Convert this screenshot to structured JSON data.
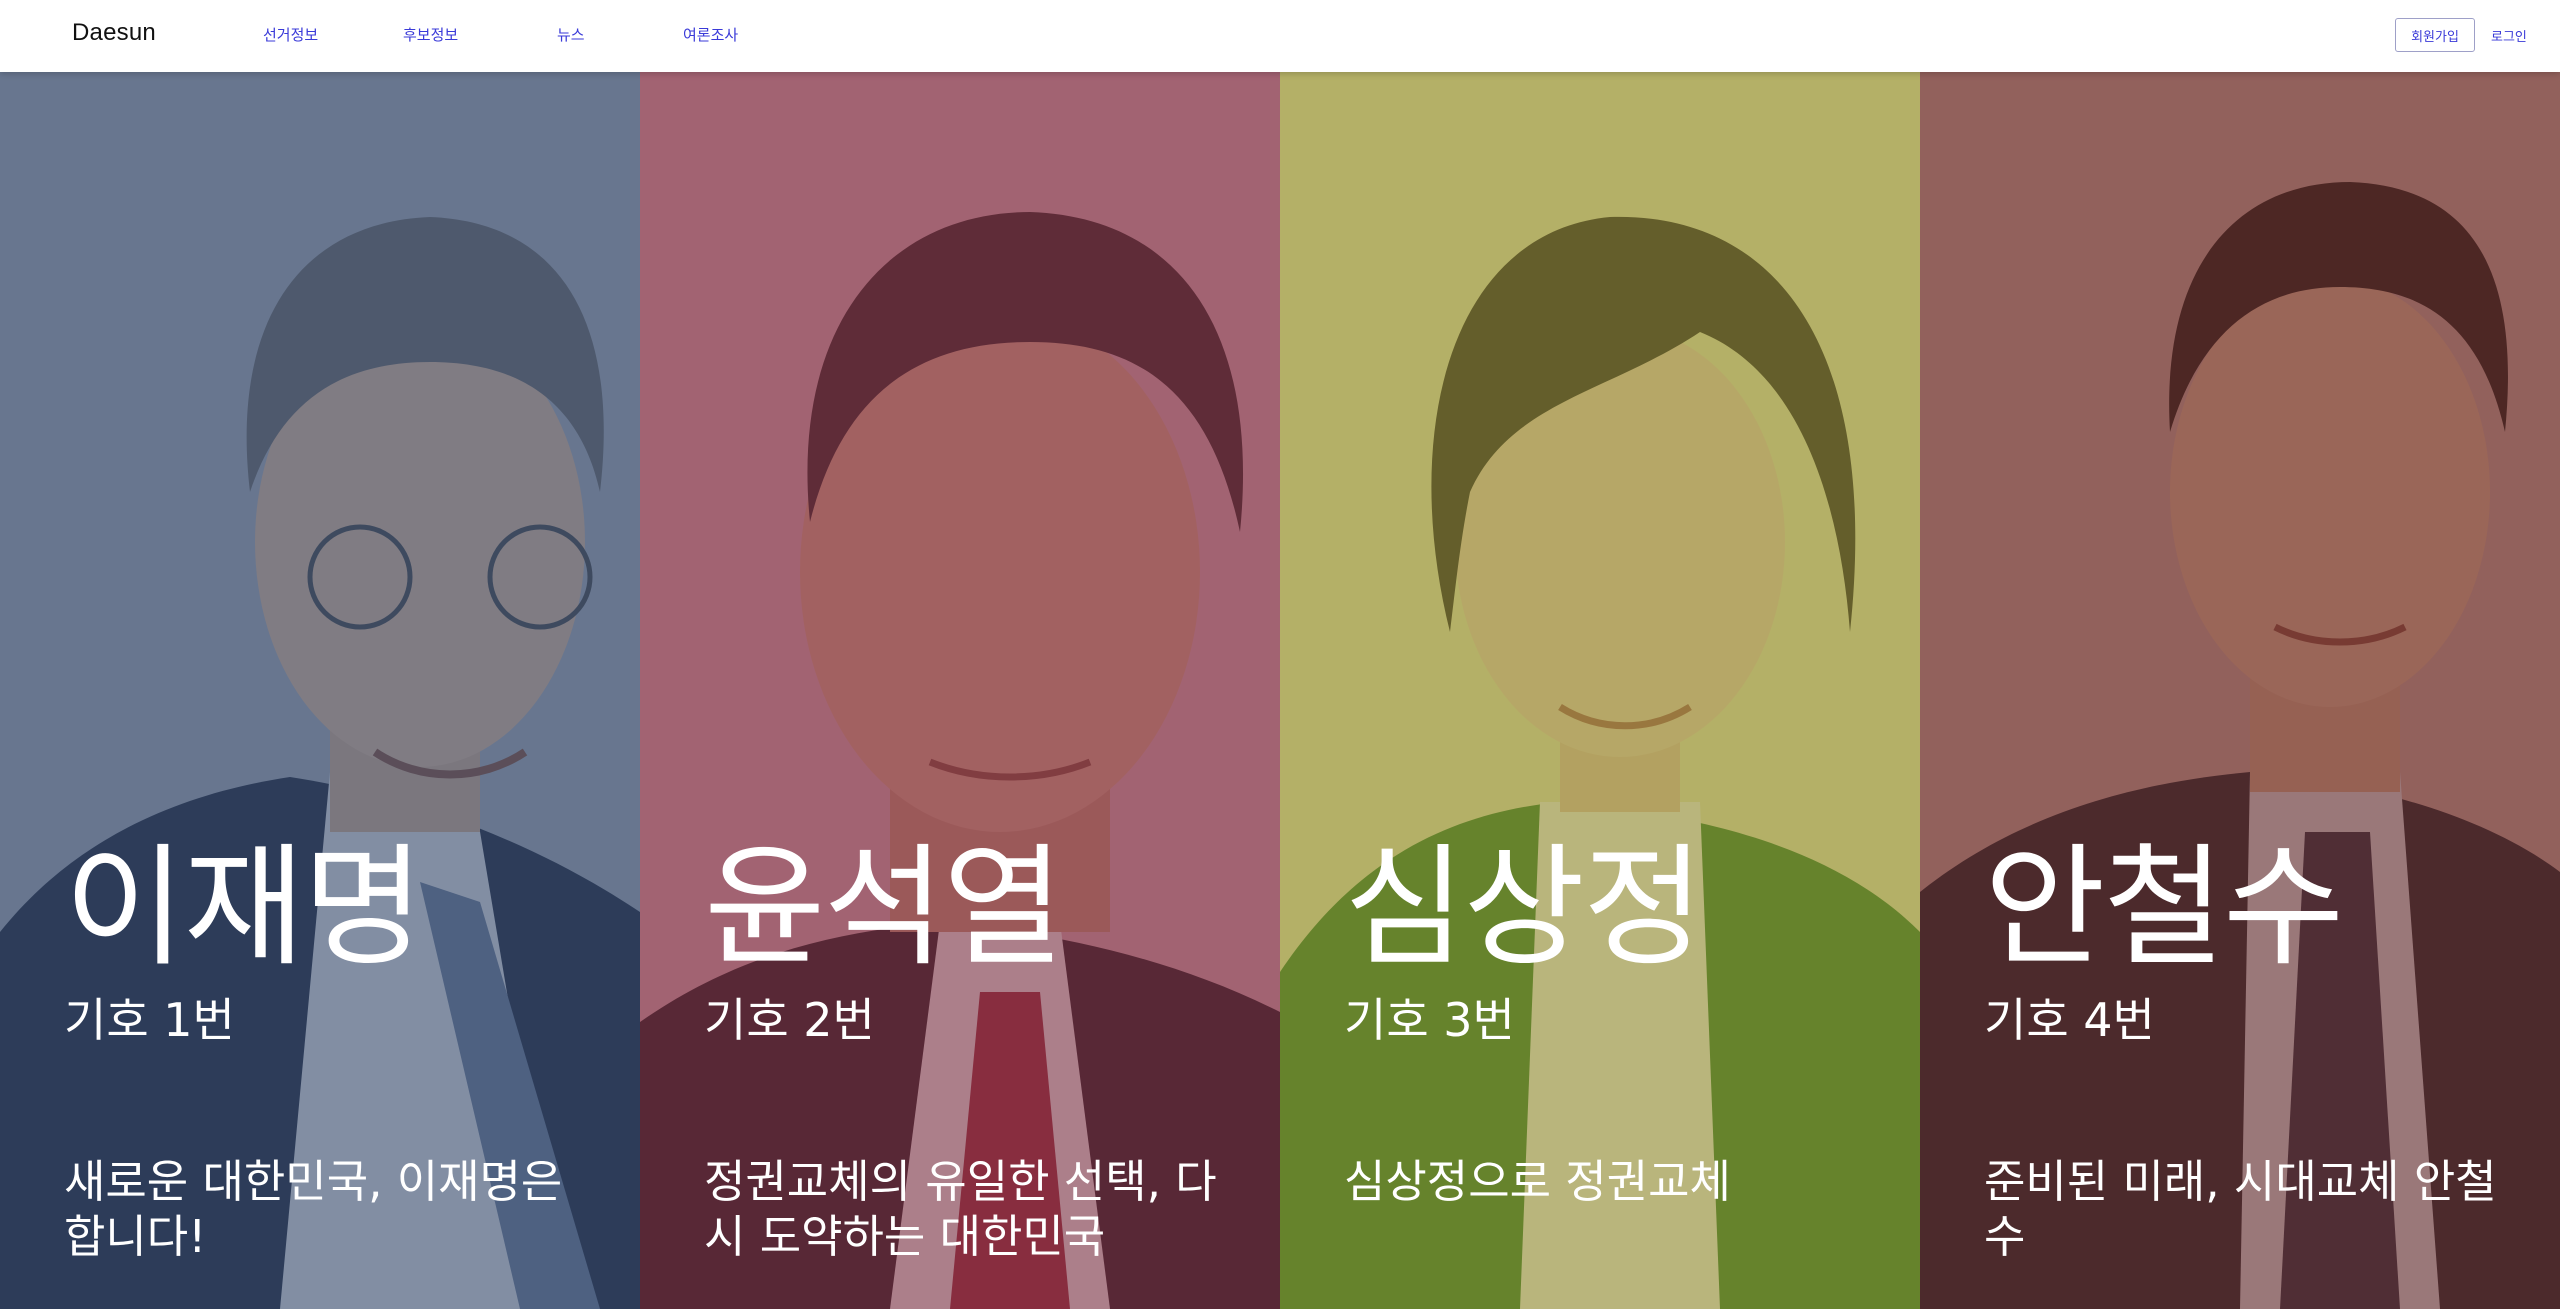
{
  "brand": "Daesun",
  "nav": {
    "items": [
      {
        "label": "선거정보"
      },
      {
        "label": "후보정보"
      },
      {
        "label": "뉴스"
      },
      {
        "label": "여론조사"
      }
    ],
    "signup_label": "회원가입",
    "login_label": "로그인"
  },
  "candidates": [
    {
      "name": "이재명",
      "number": "기호 1번",
      "slogan": "새로운 대한민국, 이재명은 합니다!",
      "tint_color": "#394a69"
    },
    {
      "name": "윤석열",
      "number": "기호 2번",
      "slogan": "정권교체의 유일한 선택, 다시 도약하는 대한민국",
      "tint_color": "#7a3345"
    },
    {
      "name": "심상정",
      "number": "기호 3번",
      "slogan": "심상정으로 정권교체",
      "tint_color": "#8f8a2e"
    },
    {
      "name": "안철수",
      "number": "기호 4번",
      "slogan": "준비된 미래, 시대교체 안철수",
      "tint_color": "#6a2f2a"
    }
  ]
}
